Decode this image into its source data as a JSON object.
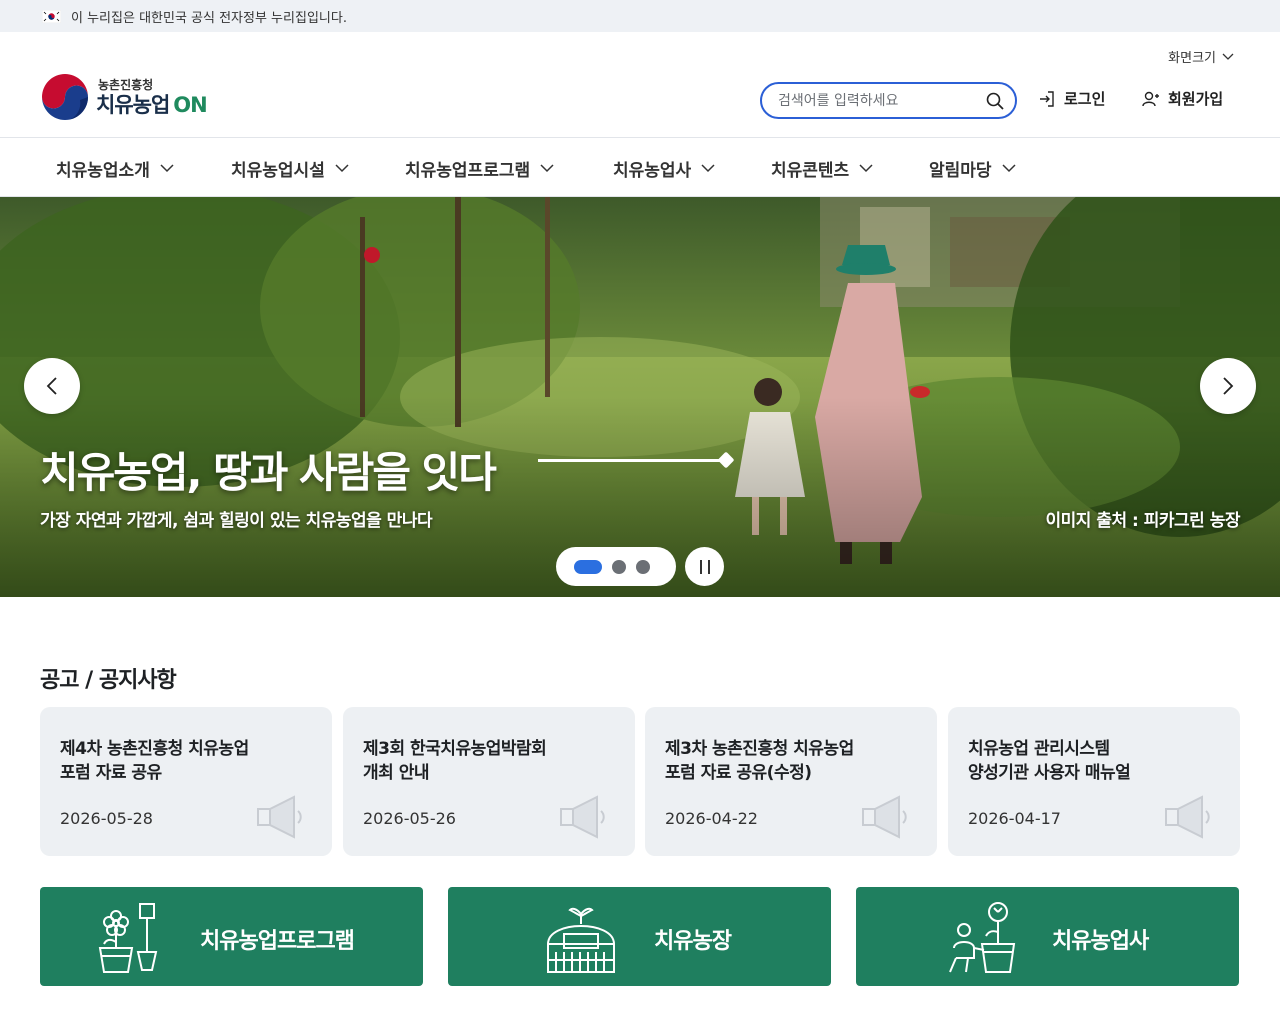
{
  "gov_banner": {
    "text": "이 누리집은 대한민국 공식 전자정부 누리집입니다.",
    "icon": "korea-flag-icon"
  },
  "header": {
    "screen_size_label": "화면크기",
    "logo": {
      "sub": "농촌진흥청",
      "main": "치유농업",
      "suffix": "ON"
    },
    "search": {
      "placeholder": "검색어를 입력하세요",
      "value": ""
    },
    "login_label": "로그인",
    "signup_label": "회원가입"
  },
  "gnb": {
    "items": [
      {
        "label": "치유농업소개"
      },
      {
        "label": "치유농업시설"
      },
      {
        "label": "치유농업프로그램"
      },
      {
        "label": "치유농업사"
      },
      {
        "label": "치유콘텐츠"
      },
      {
        "label": "알림마당"
      }
    ]
  },
  "hero": {
    "title": "치유농업, 땅과 사람을 잇다",
    "subtitle": "가장 자연과 가깝게, 쉼과 힐링이 있는 치유농업을 만나다",
    "credit": "이미지 출처 : 피카그린 농장",
    "slide_count": 3,
    "active_slide": 1
  },
  "notices": {
    "title": "공고 / 공지사항",
    "items": [
      {
        "title": "제4차 농촌진흥청 치유농업\n포럼 자료 공유",
        "date": "2026-05-28"
      },
      {
        "title": "제3회 한국치유농업박람회\n개최 안내",
        "date": "2026-05-26"
      },
      {
        "title": "제3차 농촌진흥청 치유농업\n포럼 자료 공유(수정)",
        "date": "2026-04-22"
      },
      {
        "title": "치유농업 관리시스템\n양성기관 사용자 매뉴얼",
        "date": "2026-04-17"
      }
    ]
  },
  "quick_links": [
    {
      "label": "치유농업프로그램",
      "icon": "flower-shovel-icon"
    },
    {
      "label": "치유농장",
      "icon": "greenhouse-icon"
    },
    {
      "label": "치유농업사",
      "icon": "gardener-icon"
    }
  ],
  "colors": {
    "primary_green": "#1f7f5f",
    "search_border": "#2b5fd6",
    "pager_active": "#2b6fe0"
  }
}
